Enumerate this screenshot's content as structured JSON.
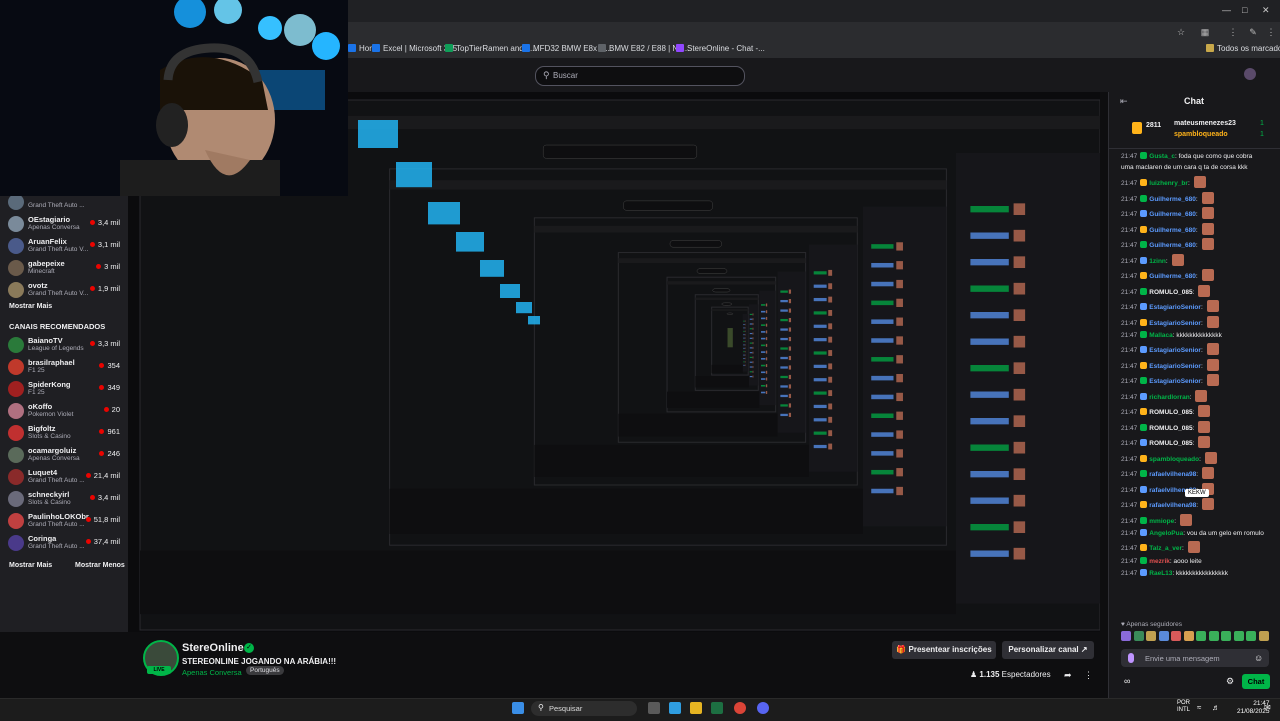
{
  "browser": {
    "bookmarks": [
      {
        "label": "Hor...",
        "color": "#1a73e8"
      },
      {
        "label": "Excel | Microsoft 365",
        "color": "#1d6f42"
      },
      {
        "label": "TopTierRamen and s...",
        "color": "#0f9d58"
      },
      {
        "label": "MFD32 BMW E8x G...",
        "color": "#1a73e8"
      },
      {
        "label": "BMW E82 / E88 | No...",
        "color": "#3c4043"
      },
      {
        "label": "StereOnline - Chat -...",
        "color": "#9147ff"
      }
    ],
    "all_bookmarks": "Todos os marcadores"
  },
  "topnav": {
    "search_placeholder": "Buscar"
  },
  "sidebar": {
    "followed": [
      {
        "name": "",
        "game": "Grand Theft Auto ...",
        "count": "",
        "color": "#5a6a7a"
      },
      {
        "name": "OEstagiario",
        "game": "Apenas Conversa",
        "count": "3,4 mil",
        "color": "#7a8a9a"
      },
      {
        "name": "AruanFelix",
        "game": "Grand Theft Auto V...",
        "count": "3,1 mil",
        "color": "#4a5a8a"
      },
      {
        "name": "gabepeixe",
        "game": "Minecraft",
        "count": "3 mil",
        "color": "#6a5a4a"
      },
      {
        "name": "ovotz",
        "game": "Grand Theft Auto V...",
        "count": "1,9 mil",
        "color": "#8a7a5a"
      }
    ],
    "show_more": "Mostrar Mais",
    "recommended_title": "CANAIS RECOMENDADOS",
    "recommended": [
      {
        "name": "BaianoTV",
        "game": "League of Legends",
        "count": "3,3 mil",
        "color": "#2a7a3a"
      },
      {
        "name": "brasilraphael",
        "game": "F1 25",
        "count": "354",
        "color": "#c0392b"
      },
      {
        "name": "SpiderKong",
        "game": "F1 25",
        "count": "349",
        "color": "#a02020"
      },
      {
        "name": "oKoffo",
        "game": "Pokemon Violet",
        "count": "20",
        "color": "#b07080"
      },
      {
        "name": "Bigfoltz",
        "game": "Slots & Casino",
        "count": "961",
        "color": "#c03030"
      },
      {
        "name": "ocamargoluiz",
        "game": "Apenas Conversa",
        "count": "246",
        "color": "#5a6a5a"
      },
      {
        "name": "Luquet4",
        "game": "Grand Theft Auto ...",
        "count": "21,4 mil",
        "color": "#8a2a2a"
      },
      {
        "name": "schneckyirl",
        "game": "Slots & Casino",
        "count": "3,4 mil",
        "color": "#6a6a7a"
      },
      {
        "name": "PaulinhoLOKObr",
        "game": "Grand Theft Auto ...",
        "count": "51,8 mil",
        "color": "#c04040"
      },
      {
        "name": "Coringa",
        "game": "Grand Theft Auto ...",
        "count": "37,4 mil",
        "color": "#4a3a8a"
      }
    ],
    "show_more2": "Mostrar Mais",
    "show_less": "Mostrar Menos"
  },
  "channel": {
    "name": "StereOnline",
    "title": "STEREONLINE JOGANDO NA ARÁBIA!!!",
    "category": "Apenas Conversa",
    "tag": "Português",
    "present_subs": "Presentear inscrições",
    "customize": "Personalizar canal",
    "viewers": "1.135",
    "viewers_label": "Espectadores",
    "live": "LIVE"
  },
  "chat": {
    "title": "Chat",
    "gift_count": "2811",
    "gift_rows": [
      {
        "user": "mateusmenezes23",
        "num": "1"
      },
      {
        "user": "spambloqueado",
        "num": "1"
      }
    ],
    "messages": [
      {
        "time": "21:47",
        "user": "Gusta_c",
        "user_color": "#00b548",
        "text": "foda que como que cobra"
      },
      {
        "time": "",
        "user": "",
        "user_color": "#efeff1",
        "text": "uma maclaren de um cara q ta de corsa kkk"
      },
      {
        "time": "21:47",
        "user": "luizhenry_br",
        "user_color": "#00b548",
        "text": ""
      },
      {
        "time": "21:47",
        "user": "Guilherme_680",
        "user_color": "#5c9bff",
        "text": ""
      },
      {
        "time": "21:47",
        "user": "Guilherme_680",
        "user_color": "#5c9bff",
        "text": ""
      },
      {
        "time": "21:47",
        "user": "Guilherme_680",
        "user_color": "#5c9bff",
        "text": ""
      },
      {
        "time": "21:47",
        "user": "Guilherme_680",
        "user_color": "#5c9bff",
        "text": ""
      },
      {
        "time": "21:47",
        "user": "1zinn",
        "user_color": "#00b548",
        "text": ""
      },
      {
        "time": "21:47",
        "user": "Guilherme_680",
        "user_color": "#5c9bff",
        "text": ""
      },
      {
        "time": "21:47",
        "user": "ROMULO_085",
        "user_color": "#efeff1",
        "text": ""
      },
      {
        "time": "21:47",
        "user": "EstagiarioSenior",
        "user_color": "#5c9bff",
        "text": ""
      },
      {
        "time": "21:47",
        "user": "EstagiarioSenior",
        "user_color": "#5c9bff",
        "text": ""
      },
      {
        "time": "21:47",
        "user": "Mallaca",
        "user_color": "#00b548",
        "text": "kkkkkkkkkkkkkk"
      },
      {
        "time": "21:47",
        "user": "EstagiarioSenior",
        "user_color": "#5c9bff",
        "text": ""
      },
      {
        "time": "21:47",
        "user": "EstagiarioSenior",
        "user_color": "#5c9bff",
        "text": ""
      },
      {
        "time": "21:47",
        "user": "EstagiarioSenior",
        "user_color": "#5c9bff",
        "text": ""
      },
      {
        "time": "21:47",
        "user": "richardlorran",
        "user_color": "#00b548",
        "text": ""
      },
      {
        "time": "21:47",
        "user": "ROMULO_085",
        "user_color": "#efeff1",
        "text": ""
      },
      {
        "time": "21:47",
        "user": "ROMULO_085",
        "user_color": "#efeff1",
        "text": ""
      },
      {
        "time": "21:47",
        "user": "ROMULO_085",
        "user_color": "#efeff1",
        "text": ""
      },
      {
        "time": "21:47",
        "user": "spambloqueado",
        "user_color": "#00b548",
        "text": ""
      },
      {
        "time": "21:47",
        "user": "rafaelvilhena98",
        "user_color": "#5c9bff",
        "text": ""
      },
      {
        "time": "21:47",
        "user": "rafaelvilhena98",
        "user_color": "#5c9bff",
        "text": ""
      },
      {
        "time": "21:47",
        "user": "rafaelvilhena98",
        "user_color": "#5c9bff",
        "text": ""
      },
      {
        "time": "21:47",
        "user": "mmiope",
        "user_color": "#00b548",
        "text": ""
      },
      {
        "time": "21:47",
        "user": "AngeloPua",
        "user_color": "#00b548",
        "text": "vou da um gelo em romulo"
      },
      {
        "time": "21:47",
        "user": "Talz_a_ver",
        "user_color": "#00b548",
        "text": ""
      },
      {
        "time": "21:47",
        "user": "mezrik",
        "user_color": "#e05050",
        "text": "aooo leite"
      },
      {
        "time": "21:47",
        "user": "RaeL13",
        "user_color": "#00b548",
        "text": "kkkkkkkkkkkkkkkk"
      }
    ],
    "tooltip": "KEKW",
    "followers_only": "Apenas seguidores",
    "input_placeholder": "Envie uma mensagem",
    "send": "Chat"
  },
  "taskbar": {
    "search": "Pesquisar",
    "lang1": "POR",
    "lang2": "INTL",
    "time": "21:47",
    "date": "21/08/2025"
  }
}
